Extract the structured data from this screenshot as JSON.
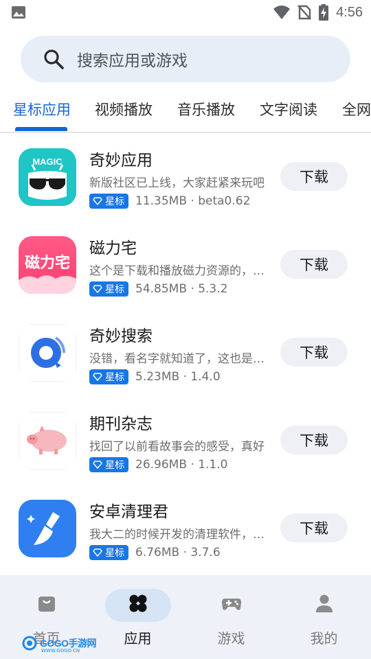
{
  "status_bar": {
    "time": "4:56"
  },
  "search": {
    "placeholder": "搜索应用或游戏"
  },
  "tabs": [
    {
      "label": "星标应用",
      "active": true
    },
    {
      "label": "视频播放",
      "active": false
    },
    {
      "label": "音乐播放",
      "active": false
    },
    {
      "label": "文字阅读",
      "active": false
    },
    {
      "label": "全网",
      "active": false
    }
  ],
  "apps": [
    {
      "name": "奇妙应用",
      "icon": "magic-app-icon",
      "icon_text": "MAGIC",
      "description": "新版社区已上线，大家赶紧来玩吧",
      "badge": "星标",
      "meta": "11.35MB · beta0.62",
      "button": "下载"
    },
    {
      "name": "磁力宅",
      "icon": "cilizhai-app-icon",
      "icon_text": "磁力宅",
      "description": "这个是下载和播放磁力资源的，很好用",
      "badge": "星标",
      "meta": "54.85MB · 5.3.2",
      "button": "下载"
    },
    {
      "name": "奇妙搜索",
      "icon": "search-app-icon",
      "description": "没错，看名字就知道了，这也是奇妙出品",
      "badge": "星标",
      "meta": "5.23MB · 1.4.0",
      "button": "下载"
    },
    {
      "name": "期刊杂志",
      "icon": "pig-app-icon",
      "description": "找回了以前看故事会的感受，真好",
      "badge": "星标",
      "meta": "26.96MB · 1.1.0",
      "button": "下载"
    },
    {
      "name": "安卓清理君",
      "icon": "broom-app-icon",
      "description": "我大二的时候开发的清理软件，很好用",
      "badge": "星标",
      "meta": "6.76MB · 3.7.6",
      "button": "下载"
    }
  ],
  "bottom_nav": [
    {
      "label": "首页",
      "icon": "home-bag-icon",
      "active": false
    },
    {
      "label": "应用",
      "icon": "apps-grid-icon",
      "active": true
    },
    {
      "label": "游戏",
      "icon": "gamepad-icon",
      "active": false
    },
    {
      "label": "我的",
      "icon": "person-icon",
      "active": false
    }
  ],
  "watermark": {
    "text": "GOGO手游网",
    "sub": "WWW.GOGO.CN"
  },
  "colors": {
    "accent": "#1565d8",
    "badge": "#1976e6",
    "search_bg": "#e8eef7",
    "nav_bg": "#eef1f8"
  }
}
